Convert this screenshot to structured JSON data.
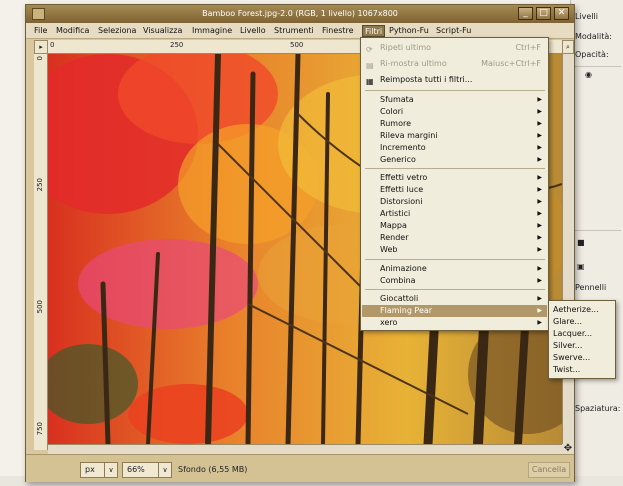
{
  "window": {
    "title": "Bamboo Forest.jpg-2.0 (RGB, 1 livello) 1067x800",
    "buttons": [
      "_",
      "□",
      "✕"
    ]
  },
  "menubar": {
    "items": [
      "File",
      "Modifica",
      "Seleziona",
      "Visualizza",
      "Immagine",
      "Livello",
      "Strumenti",
      "Finestre",
      "Filtri",
      "Python-Fu",
      "Script-Fu"
    ],
    "active": "Filtri"
  },
  "rulers": {
    "top_labels": [
      "0",
      "250",
      "500"
    ],
    "left_labels": [
      "0",
      "250",
      "500",
      "750"
    ]
  },
  "filters_menu": {
    "repeat_last": {
      "label": "Ripeti ultimo",
      "shortcut": "Ctrl+F"
    },
    "reshow_last": {
      "label": "Ri-mostra ultimo",
      "shortcut": "Maiusc+Ctrl+F"
    },
    "reset_all": {
      "label": "Reimposta tutti i filtri..."
    },
    "group1": [
      "Sfumata",
      "Colori",
      "Rumore",
      "Rileva margini",
      "Incremento",
      "Generico"
    ],
    "group2": [
      "Effetti vetro",
      "Effetti luce",
      "Distorsioni",
      "Artistici",
      "Mappa",
      "Render",
      "Web"
    ],
    "group3": [
      "Animazione",
      "Combina"
    ],
    "group4": [
      "Giocattoli",
      "Flaming Pear",
      "xero"
    ],
    "highlighted": "Flaming Pear"
  },
  "flaming_pear_submenu": [
    "Aetherize...",
    "Glare...",
    "Lacquer...",
    "Silver...",
    "Swerve...",
    "Twist..."
  ],
  "statusbar": {
    "unit": "px",
    "zoom": "66%",
    "status": "Sfondo (6,55 MB)",
    "cancel": "Cancella"
  },
  "right_panel": {
    "texts": [
      "Livelli",
      "Modalità:",
      "Opacità:",
      "Pennelli",
      "Spaziatura:"
    ]
  },
  "colors": {
    "title_bar": "#8e7444",
    "menu_highlight": "#b29868",
    "canvas_red": "#e0302a",
    "canvas_orange": "#f09a2a"
  }
}
